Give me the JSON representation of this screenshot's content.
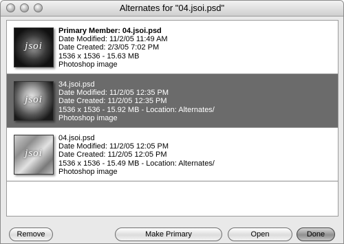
{
  "window": {
    "title": "Alternates for \"04.jsoi.psd\""
  },
  "items": [
    {
      "name": "Primary Member: 04.jsoi.psd",
      "modified": "Date Modified: 11/2/05 11:49 AM",
      "created": "Date Created: 2/3/05 7:02 PM",
      "size": "1536 x 1536 - 15.63 MB",
      "kind": "Photoshop image",
      "thumb_logo": "jsoi"
    },
    {
      "name": "34.jsoi.psd",
      "modified": "Date Modified: 11/2/05 12:35 PM",
      "created": "Date Created: 11/2/05 12:35 PM",
      "size": "1536 x 1536 - 15.92 MB - Location: Alternates/",
      "kind": "Photoshop image",
      "thumb_logo": "jsoi"
    },
    {
      "name": "04.jsoi.psd",
      "modified": "Date Modified: 11/2/05 12:05 PM",
      "created": "Date Created: 11/2/05 12:05 PM",
      "size": "1536 x 1536 - 15.49 MB - Location: Alternates/",
      "kind": "Photoshop image",
      "thumb_logo": "jsoi"
    }
  ],
  "buttons": {
    "remove": "Remove",
    "make_primary": "Make Primary",
    "open": "Open",
    "done": "Done"
  }
}
